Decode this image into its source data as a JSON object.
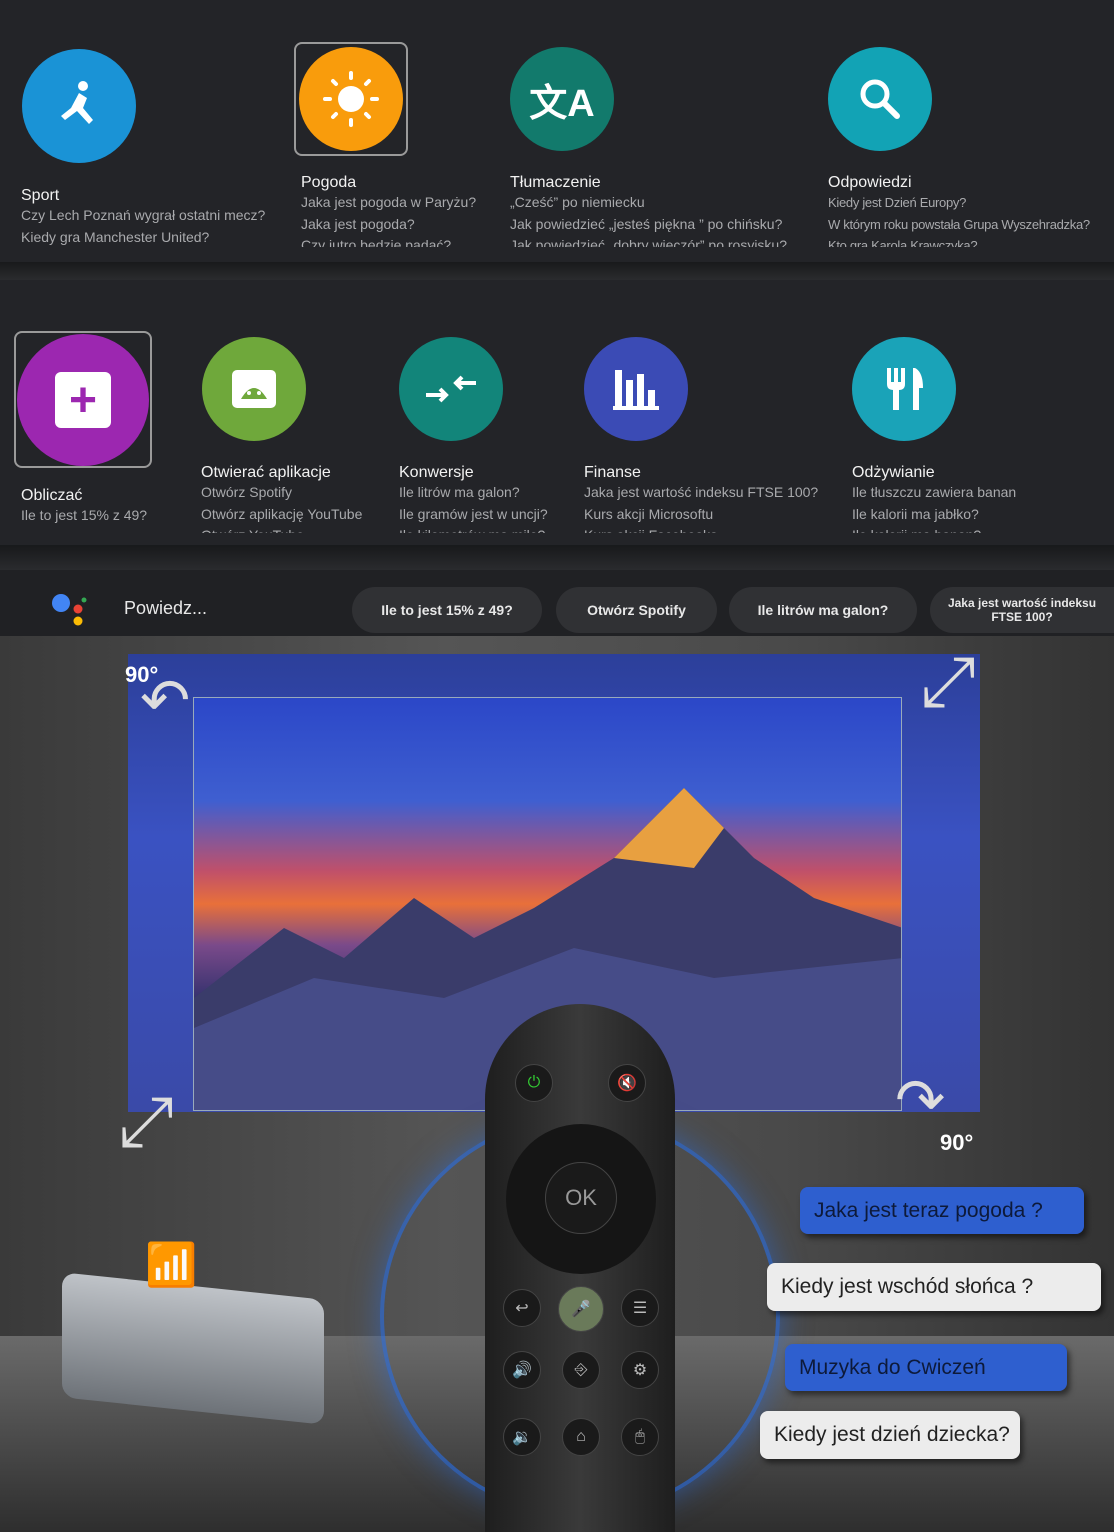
{
  "row1": [
    {
      "title": "Sport",
      "icon": "sport-icon",
      "color": "#1a93d6",
      "subs": [
        "Czy Lech Poznań wygrał ostatni mecz?",
        "Kiedy gra Manchester United?"
      ]
    },
    {
      "title": "Pogoda",
      "icon": "sun-icon",
      "color": "#f99c0c",
      "subs": [
        "Jaka jest pogoda w Paryżu?",
        "Jaka jest pogoda?",
        "Czy jutro będzie padać?"
      ]
    },
    {
      "title": "Tłumaczenie",
      "icon": "translate-icon",
      "color": "#127a6c",
      "subs": [
        "„Cześć” po niemiecku",
        "Jak powiedzieć „jesteś piękna ” po chińsku?",
        "Jak powiedzieć „dobry wieczór” po rosyjsku?"
      ]
    },
    {
      "title": "Odpowiedzi",
      "icon": "search-icon",
      "color": "#12a3b5",
      "subs": [
        "Kiedy jest Dzień Europy?",
        "W którym roku powstała Grupa Wyszehradzka?",
        "Kto gra Karola Krawczyka?"
      ]
    }
  ],
  "row2": [
    {
      "title": "Obliczać",
      "icon": "plus-icon",
      "color": "#9c27b0",
      "subs": [
        "Ile to jest 15% z 49?"
      ]
    },
    {
      "title": "Otwierać aplikacje",
      "icon": "android-icon",
      "color": "#6fa83b",
      "subs": [
        "Otwórz Spotify",
        "Otwórz aplikację YouTube",
        "Otwórz YouTube"
      ]
    },
    {
      "title": "Konwersje",
      "icon": "convert-icon",
      "color": "#12857a",
      "subs": [
        "Ile litrów ma galon?",
        "Ile gramów jest w uncji?",
        "Ile kilometrów ma milę?"
      ]
    },
    {
      "title": "Finanse",
      "icon": "bar-chart-icon",
      "color": "#3b4bb5",
      "subs": [
        "Jaka jest wartość indeksu FTSE 100?",
        "Kurs akcji Microsoftu",
        "Kurs akcji Facebooka"
      ]
    },
    {
      "title": "Odżywianie",
      "icon": "utensils-icon",
      "color": "#1aa3b8",
      "subs": [
        "Ile tłuszczu zawiera banan",
        "Ile kalorii ma jabłko?",
        "Ile kalorii ma banan?"
      ]
    }
  ],
  "assistant": {
    "prompt": "Powiedz...",
    "chips": [
      "Ile to jest 15% z 49?",
      "Otwórz Spotify",
      "Ile litrów ma galon?",
      "Jaka jest wartość indeksu FTSE 100?"
    ]
  },
  "photo": {
    "deg_top": "90°",
    "deg_bottom": "90°",
    "ok": "OK",
    "bubbles": [
      "Jaka jest teraz pogoda ?",
      "Kiedy jest wschód słońca ?",
      "Muzyka do Cwiczeń",
      "Kiedy jest dzień dziecka?"
    ]
  }
}
